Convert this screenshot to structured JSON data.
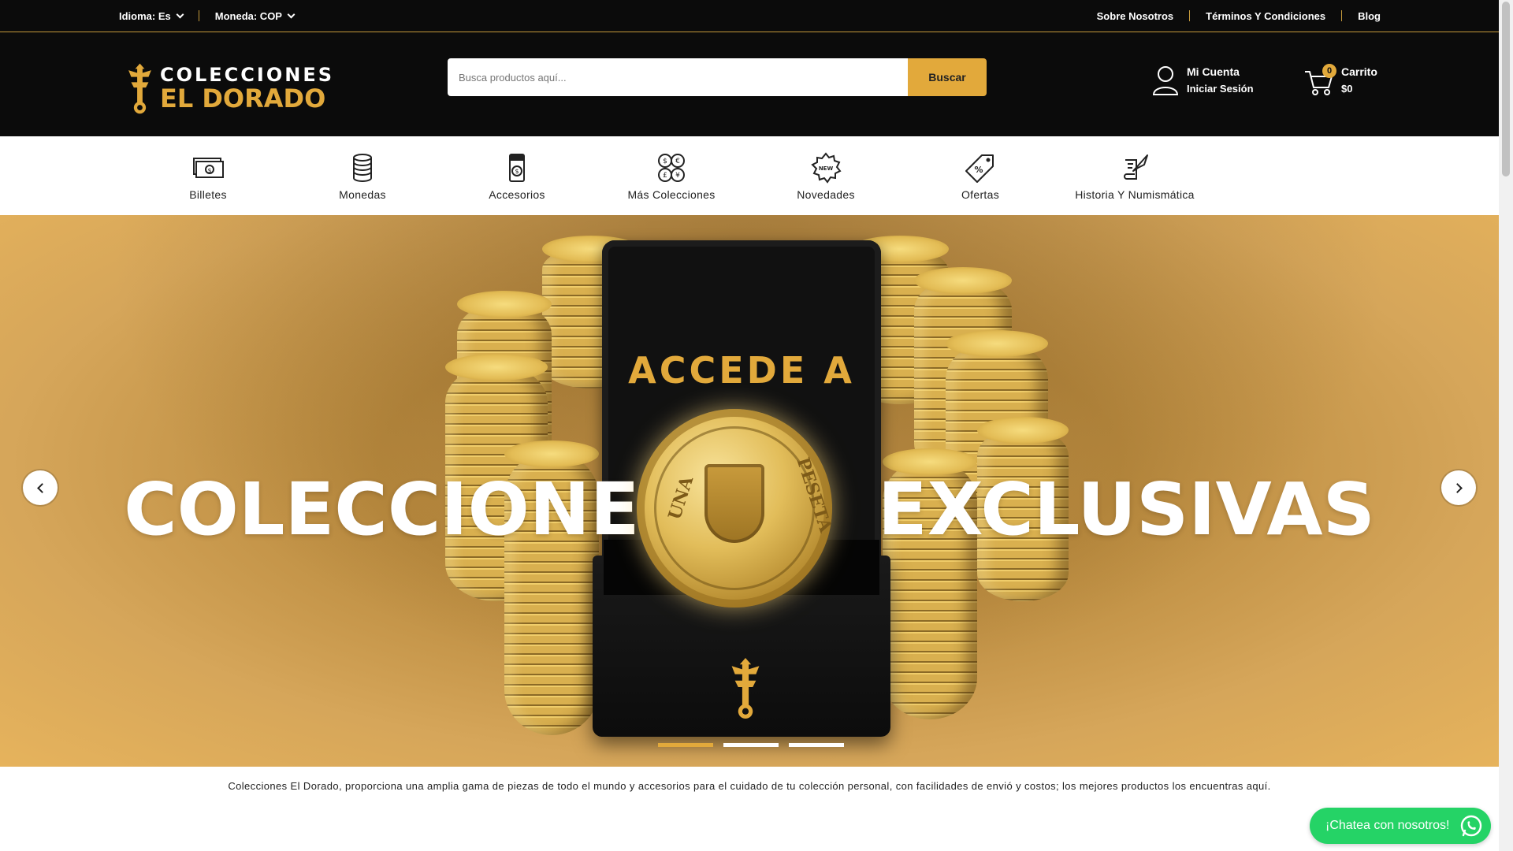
{
  "topbar": {
    "language_label": "Idioma: Es",
    "currency_label": "Moneda: COP",
    "links": [
      "Sobre Nosotros",
      "Términos Y Condiciones",
      "Blog"
    ]
  },
  "brand": {
    "logo_line1": "COLECCIONES",
    "logo_line2": "EL DORADO",
    "accent_color": "#e2a93b"
  },
  "search": {
    "placeholder": "Busca productos aquí...",
    "button_label": "Buscar"
  },
  "account": {
    "title": "Mi Cuenta",
    "subtitle": "Iniciar Sesión",
    "icon": "user-icon"
  },
  "cart": {
    "title": "Carrito",
    "total": "$0",
    "count": "0",
    "icon": "cart-icon"
  },
  "categories": [
    {
      "label": "Billetes",
      "icon": "banknotes-icon"
    },
    {
      "label": "Monedas",
      "icon": "coin-stack-icon"
    },
    {
      "label": "Accesorios",
      "icon": "coin-holder-icon"
    },
    {
      "label": "Más Colecciones",
      "icon": "currencies-icon"
    },
    {
      "label": "Novedades",
      "icon": "new-badge-icon"
    },
    {
      "label": "Ofertas",
      "icon": "discount-tag-icon"
    },
    {
      "label": "Historia Y Numismática",
      "icon": "quill-scroll-icon"
    }
  ],
  "hero": {
    "overline": "ACCEDE A",
    "title_left": "COLECCIONES",
    "title_right": "EXCLUSIVAS",
    "coin_legend_left": "UNA",
    "coin_legend_right": "PESETA",
    "slides_total": 3,
    "active_slide": 1
  },
  "tagline": "Colecciones El Dorado, proporciona una amplia gama de piezas de todo el mundo y accesorios para el cuidado de tu colección personal, con facilidades de envió y costos; los mejores productos los encuentras aquí.",
  "chat": {
    "label": "¡Chatea con nosotros!",
    "color": "#25d366",
    "icon": "whatsapp-icon"
  }
}
